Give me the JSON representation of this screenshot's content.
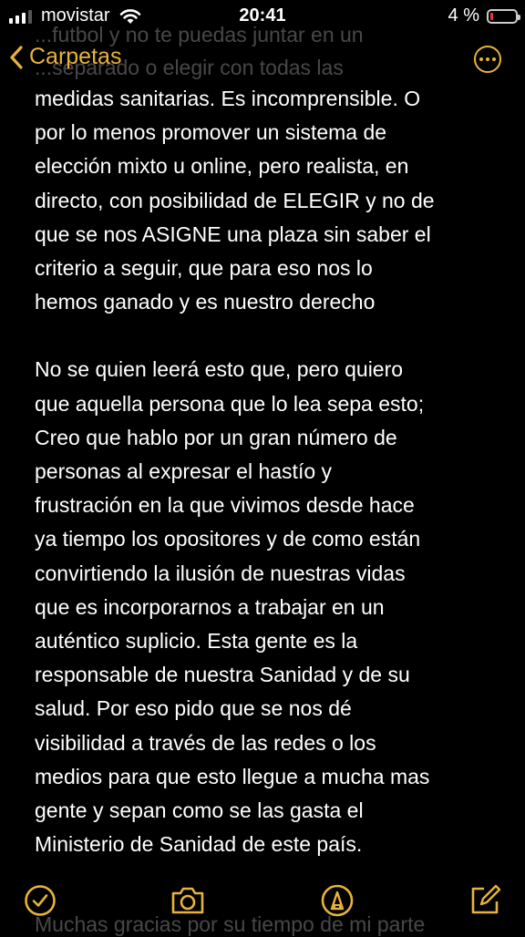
{
  "status_bar": {
    "carrier": "movistar",
    "time": "20:41",
    "battery_text": "4 %",
    "battery_level": 0.04,
    "signal_bars_active": 3,
    "signal_bars_total": 4
  },
  "nav": {
    "back_label": "Carpetas",
    "back_icon": "chevron-left-icon",
    "more_icon": "ellipsis-circle-icon"
  },
  "ghost_top": [
    "...futbol y no te puedas juntar en un",
    "...separado o elegir con todas las"
  ],
  "note": {
    "paragraphs": [
      "medidas sanitarias. Es incomprensible. O\npor lo menos promover un sistema de\nelección mixto u online, pero realista, en\ndirecto, con posibilidad de ELEGIR y no de\nque se nos ASIGNE una plaza sin saber el\ncriterio a seguir, que para eso nos lo\nhemos ganado y es nuestro derecho",
      "No se quien leerá esto que, pero quiero\nque aquella persona que lo lea sepa esto;\nCreo que hablo por un gran número de\npersonas al expresar el hastío y\nfrustración en la que vivimos desde hace\nya tiempo los opositores y de como están\nconvirtiendo la ilusión de nuestras vidas\nque es incorporarnos a trabajar en un\nauténtico suplicio. Esta gente es la\nresponsable de nuestra Sanidad y de su\nsalud. Por eso pido que se nos dé\nvisibilidad a través de las redes o los\nmedios para que esto llegue a mucha mas\ngente y sepan como se las gasta el\nMinisterio de Sanidad de este país."
    ]
  },
  "ghost_bottom": "Muchas gracias por su tiempo de mi parte",
  "toolbar": {
    "checklist_icon": "checkmark-circle-icon",
    "camera_icon": "camera-icon",
    "markup_icon": "pen-circle-icon",
    "compose_icon": "compose-icon"
  },
  "colors": {
    "accent": "#e7b33c",
    "background": "#000000",
    "text": "#ffffff",
    "battery_low": "#e03b2e"
  }
}
